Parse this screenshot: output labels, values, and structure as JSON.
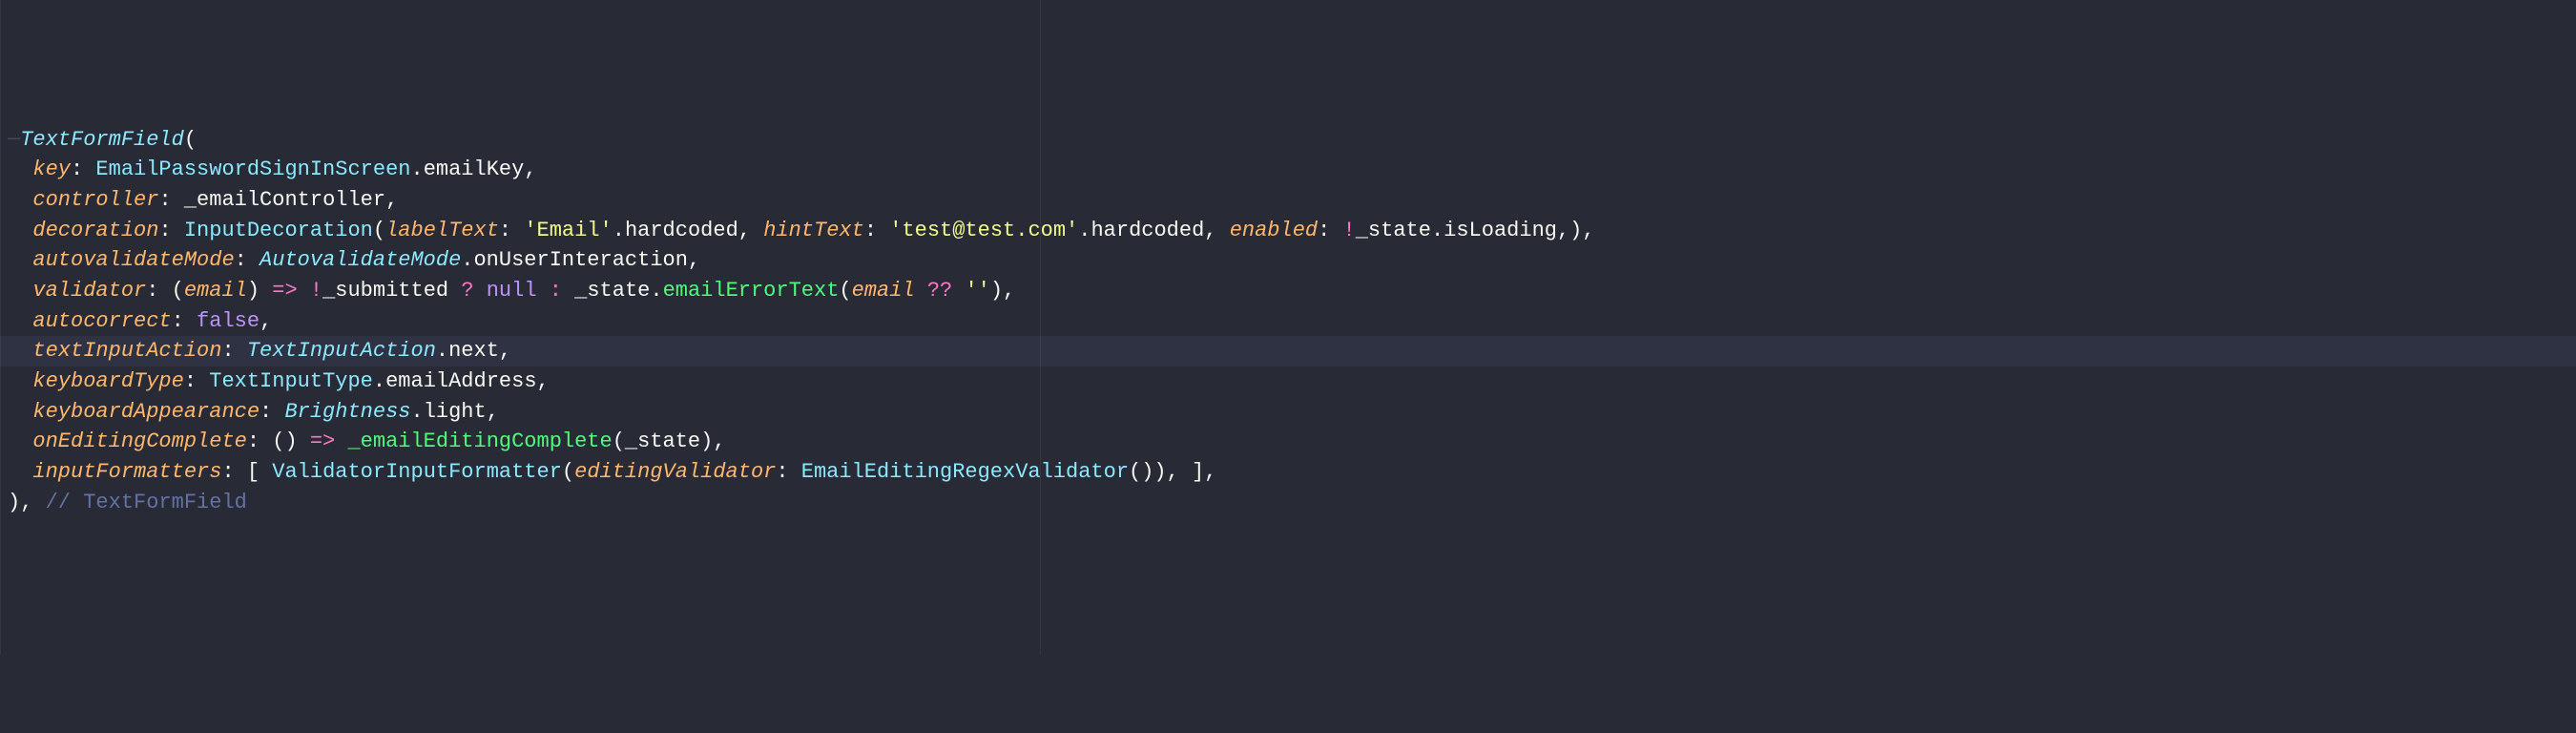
{
  "theme": {
    "background": "#282a36",
    "highlight_line_bg": "#2f3242",
    "colors": {
      "type": "#8be9fd",
      "param": "#ffb86c",
      "identifier": "#f8f8f2",
      "operator": "#ff79c6",
      "string": "#f1fa8c",
      "constant": "#bd93f9",
      "call": "#50fa7b",
      "comment": "#6272a4",
      "guide": "#44475a"
    }
  },
  "code": {
    "language": "dart",
    "widget": "TextFormField",
    "closing_comment": "// TextFormField",
    "lines": [
      {
        "indent": 0,
        "tokens": [
          {
            "t": "guide",
            "v": "─"
          },
          {
            "t": "type",
            "v": "TextFormField"
          },
          {
            "t": "punct",
            "v": "("
          }
        ]
      },
      {
        "indent": 1,
        "tokens": [
          {
            "t": "param",
            "v": "key"
          },
          {
            "t": "punct",
            "v": ": "
          },
          {
            "t": "type-ni",
            "v": "EmailPasswordSignInScreen"
          },
          {
            "t": "punct",
            "v": "."
          },
          {
            "t": "ident",
            "v": "emailKey"
          },
          {
            "t": "punct",
            "v": ","
          }
        ]
      },
      {
        "indent": 1,
        "tokens": [
          {
            "t": "param",
            "v": "controller"
          },
          {
            "t": "punct",
            "v": ": "
          },
          {
            "t": "ident",
            "v": "_emailController"
          },
          {
            "t": "punct",
            "v": ","
          }
        ]
      },
      {
        "indent": 1,
        "tokens": [
          {
            "t": "param",
            "v": "decoration"
          },
          {
            "t": "punct",
            "v": ": "
          },
          {
            "t": "type-ni",
            "v": "InputDecoration"
          },
          {
            "t": "punct",
            "v": "("
          },
          {
            "t": "param",
            "v": "labelText"
          },
          {
            "t": "punct",
            "v": ": "
          },
          {
            "t": "str",
            "v": "'Email'"
          },
          {
            "t": "punct",
            "v": "."
          },
          {
            "t": "ident",
            "v": "hardcoded"
          },
          {
            "t": "punct",
            "v": ", "
          },
          {
            "t": "param",
            "v": "hintText"
          },
          {
            "t": "punct",
            "v": ": "
          },
          {
            "t": "str",
            "v": "'test@test.com'"
          },
          {
            "t": "punct",
            "v": "."
          },
          {
            "t": "ident",
            "v": "hardcoded"
          },
          {
            "t": "punct",
            "v": ", "
          },
          {
            "t": "param",
            "v": "enabled"
          },
          {
            "t": "punct",
            "v": ": "
          },
          {
            "t": "op",
            "v": "!"
          },
          {
            "t": "ident",
            "v": "_state"
          },
          {
            "t": "punct",
            "v": "."
          },
          {
            "t": "ident",
            "v": "isLoading"
          },
          {
            "t": "punct",
            "v": ",),"
          }
        ]
      },
      {
        "indent": 1,
        "tokens": [
          {
            "t": "param",
            "v": "autovalidateMode"
          },
          {
            "t": "punct",
            "v": ": "
          },
          {
            "t": "type",
            "v": "AutovalidateMode"
          },
          {
            "t": "punct",
            "v": "."
          },
          {
            "t": "ident",
            "v": "onUserInteraction"
          },
          {
            "t": "punct",
            "v": ","
          }
        ]
      },
      {
        "indent": 1,
        "tokens": [
          {
            "t": "param",
            "v": "validator"
          },
          {
            "t": "punct",
            "v": ": ("
          },
          {
            "t": "param",
            "v": "email"
          },
          {
            "t": "punct",
            "v": ") "
          },
          {
            "t": "op",
            "v": "=>"
          },
          {
            "t": "punct",
            "v": " "
          },
          {
            "t": "op",
            "v": "!"
          },
          {
            "t": "ident",
            "v": "_submitted "
          },
          {
            "t": "op",
            "v": "?"
          },
          {
            "t": "punct",
            "v": " "
          },
          {
            "t": "bool",
            "v": "null"
          },
          {
            "t": "punct",
            "v": " "
          },
          {
            "t": "op",
            "v": ":"
          },
          {
            "t": "punct",
            "v": " _state."
          },
          {
            "t": "call",
            "v": "emailErrorText"
          },
          {
            "t": "punct",
            "v": "("
          },
          {
            "t": "param",
            "v": "email"
          },
          {
            "t": "punct",
            "v": " "
          },
          {
            "t": "op",
            "v": "??"
          },
          {
            "t": "punct",
            "v": " "
          },
          {
            "t": "str",
            "v": "''"
          },
          {
            "t": "punct",
            "v": "),"
          }
        ]
      },
      {
        "indent": 1,
        "tokens": [
          {
            "t": "param",
            "v": "autocorrect"
          },
          {
            "t": "punct",
            "v": ": "
          },
          {
            "t": "bool",
            "v": "false"
          },
          {
            "t": "punct",
            "v": ","
          }
        ]
      },
      {
        "indent": 1,
        "highlight": true,
        "tokens": [
          {
            "t": "param",
            "v": "textInputAction"
          },
          {
            "t": "punct",
            "v": ": "
          },
          {
            "t": "type",
            "v": "TextInputAction"
          },
          {
            "t": "punct",
            "v": "."
          },
          {
            "t": "ident",
            "v": "next"
          },
          {
            "t": "punct",
            "v": ","
          }
        ]
      },
      {
        "indent": 1,
        "tokens": [
          {
            "t": "param",
            "v": "keyboardType"
          },
          {
            "t": "punct",
            "v": ": "
          },
          {
            "t": "type-ni",
            "v": "TextInputType"
          },
          {
            "t": "punct",
            "v": "."
          },
          {
            "t": "ident",
            "v": "emailAddress"
          },
          {
            "t": "punct",
            "v": ","
          }
        ]
      },
      {
        "indent": 1,
        "tokens": [
          {
            "t": "param",
            "v": "keyboardAppearance"
          },
          {
            "t": "punct",
            "v": ": "
          },
          {
            "t": "type",
            "v": "Brightness"
          },
          {
            "t": "punct",
            "v": "."
          },
          {
            "t": "ident",
            "v": "light"
          },
          {
            "t": "punct",
            "v": ","
          }
        ]
      },
      {
        "indent": 1,
        "tokens": [
          {
            "t": "param",
            "v": "onEditingComplete"
          },
          {
            "t": "punct",
            "v": ": () "
          },
          {
            "t": "op",
            "v": "=>"
          },
          {
            "t": "punct",
            "v": " "
          },
          {
            "t": "call",
            "v": "_emailEditingComplete"
          },
          {
            "t": "punct",
            "v": "(_state),"
          }
        ]
      },
      {
        "indent": 1,
        "tokens": [
          {
            "t": "param",
            "v": "inputFormatters"
          },
          {
            "t": "punct",
            "v": ": [ "
          },
          {
            "t": "type-ni",
            "v": "ValidatorInputFormatter"
          },
          {
            "t": "punct",
            "v": "("
          },
          {
            "t": "param",
            "v": "editingValidator"
          },
          {
            "t": "punct",
            "v": ": "
          },
          {
            "t": "type-ni",
            "v": "EmailEditingRegexValidator"
          },
          {
            "t": "punct",
            "v": "()), ],"
          }
        ]
      },
      {
        "indent": 0,
        "tokens": [
          {
            "t": "punct",
            "v": "),"
          },
          {
            "t": "punct",
            "v": " "
          },
          {
            "t": "comment",
            "v": "// TextFormField"
          }
        ]
      }
    ]
  }
}
